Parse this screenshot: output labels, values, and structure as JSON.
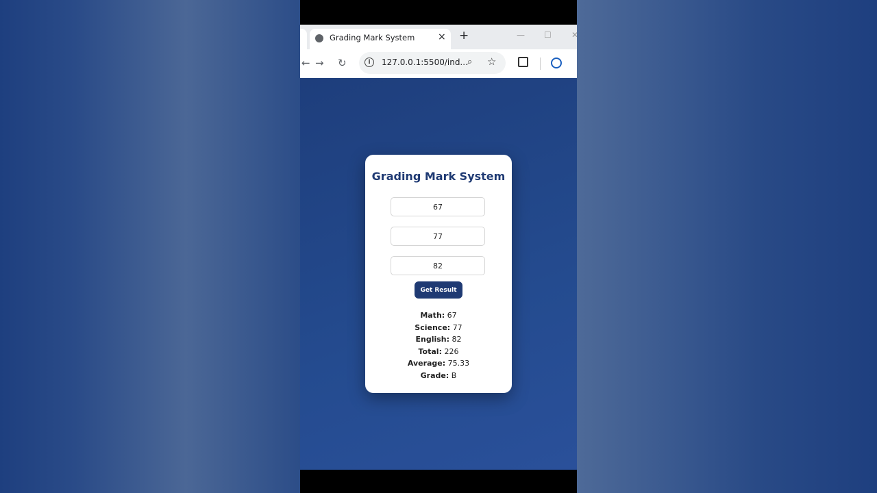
{
  "browser": {
    "tab_title": "Grading Mark System",
    "tab_close": "×",
    "new_tab": "+",
    "url": "127.0.0.1:5500/ind...",
    "window_controls": [
      "—",
      "☐",
      "✕"
    ]
  },
  "app": {
    "title": "Grading Mark System",
    "inputs": {
      "math": "67",
      "science": "77",
      "english": "82"
    },
    "button_label": "Get Result",
    "results": {
      "math_label": "Math:",
      "math_value": "67",
      "science_label": "Science:",
      "science_value": "77",
      "english_label": "English:",
      "english_value": "82",
      "total_label": "Total:",
      "total_value": "226",
      "average_label": "Average:",
      "average_value": "75.33",
      "grade_label": "Grade:",
      "grade_value": "B"
    }
  },
  "colors": {
    "accent": "#1f3a73",
    "background": "#234888"
  },
  "icons": [
    "globe-icon",
    "back-icon",
    "forward-icon",
    "reload-icon",
    "info-icon",
    "zoom-icon",
    "star-icon",
    "extensions-icon",
    "profile-icon"
  ]
}
